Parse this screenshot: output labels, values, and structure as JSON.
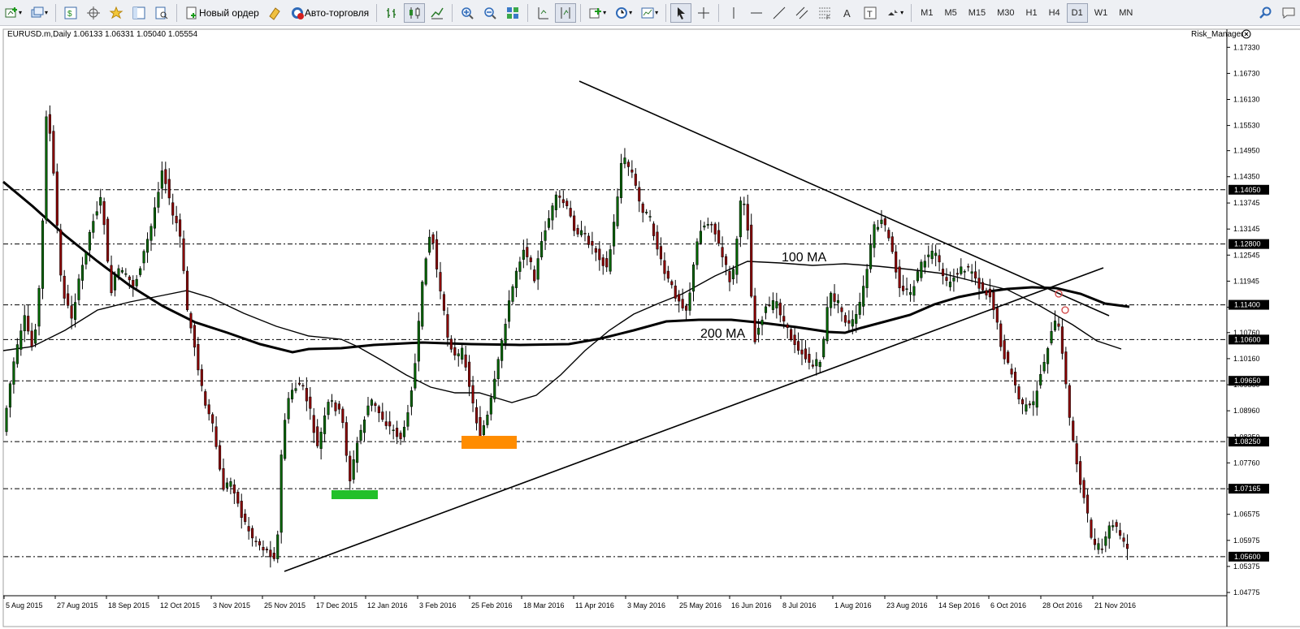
{
  "toolbar": {
    "new_order_label": "Новый ордер",
    "autotrading_label": "Авто-торговля",
    "timeframes": [
      "M1",
      "M5",
      "M15",
      "M30",
      "H1",
      "H4",
      "D1",
      "W1",
      "MN"
    ],
    "active_timeframe": "D1"
  },
  "chart": {
    "header": "EURUSD.m,Daily  1.06133 1.06331 1.05040 1.05554",
    "indicator_label": "Risk_Manager",
    "ma100_label": "100 MA",
    "ma200_label": "200 MA",
    "price_ticks": [
      "1.17330",
      "1.16730",
      "1.16130",
      "1.15530",
      "1.14950",
      "1.14350",
      "1.13745",
      "1.13145",
      "1.12545",
      "1.11945",
      "1.11345",
      "1.10760",
      "1.10160",
      "1.09560",
      "1.08960",
      "1.08350",
      "1.07760",
      "1.07160",
      "1.06575",
      "1.05975",
      "1.05375",
      "1.04775"
    ],
    "level_lines": [
      "1.14050",
      "1.12800",
      "1.11400",
      "1.10600",
      "1.09650",
      "1.08250",
      "1.07165",
      "1.05600"
    ],
    "current_price": "1.05554",
    "date_ticks": [
      "5 Aug 2015",
      "27 Aug 2015",
      "18 Sep 2015",
      "12 Oct 2015",
      "3 Nov 2015",
      "25 Nov 2015",
      "17 Dec 2015",
      "12 Jan 2016",
      "3 Feb 2016",
      "25 Feb 2016",
      "18 Mar 2016",
      "11 Apr 2016",
      "3 May 2016",
      "25 May 2016",
      "16 Jun 2016",
      "8 Jul 2016",
      "1 Aug 2016",
      "23 Aug 2016",
      "14 Sep 2016",
      "6 Oct 2016",
      "28 Oct 2016",
      "21 Nov 2016"
    ],
    "colors": {
      "bull": "#006400",
      "bear": "#8b0000",
      "ma": "#000000",
      "level": "#000000",
      "green_box": "#22c02a",
      "orange_box": "#ff8c00"
    }
  }
}
